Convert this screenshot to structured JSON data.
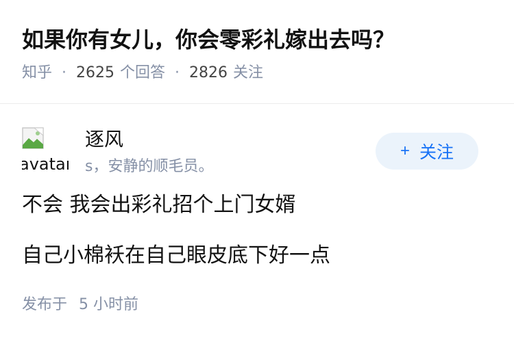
{
  "question": {
    "title": "如果你有女儿，你会零彩礼嫁出去吗？",
    "source": "知乎",
    "answers_count": "2625",
    "answers_label": "个回答",
    "followers_count": "2826",
    "followers_label": "关注"
  },
  "answer": {
    "avatar_alt": "avatar",
    "author_name": "逐风",
    "author_bio": "s，安静的顺毛员。",
    "follow_plus": "+",
    "follow_label": "关注",
    "paragraphs": [
      "不会 我会出彩礼招个上门女婿",
      "自己小棉袄在自己眼皮底下好一点"
    ],
    "posted_prefix": "发布于",
    "posted_time": "5 小时前"
  },
  "colors": {
    "accent": "#1772f6",
    "button_bg": "#ebf3fb",
    "muted": "#8590a6",
    "text": "#121212"
  }
}
